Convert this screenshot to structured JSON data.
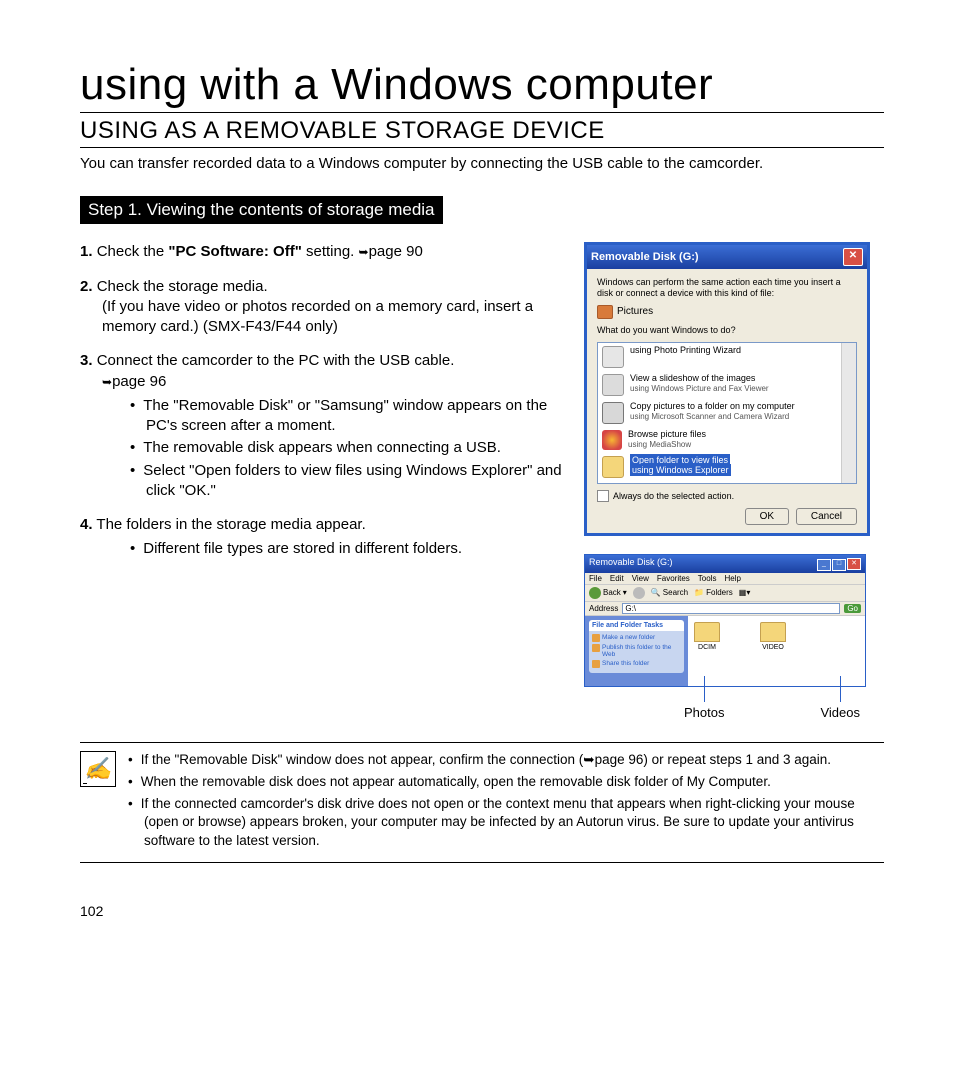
{
  "chapter_title": "using with a Windows computer",
  "section_title": "USING AS A REMOVABLE STORAGE DEVICE",
  "intro": "You can transfer recorded data to a Windows computer by connecting the USB cable to the camcorder.",
  "step_heading": "Step 1. Viewing the contents of storage media",
  "steps": [
    {
      "num": "1.",
      "pre": "Check the ",
      "bold": "\"PC Software: Off\"",
      "post": " setting. ",
      "ref": "page 90"
    },
    {
      "num": "2.",
      "text": "Check the storage media.",
      "sub": "(If you have video or photos recorded on a memory card, insert a memory card.) (SMX-F43/F44 only)"
    },
    {
      "num": "3.",
      "text": "Connect the camcorder to the PC with the USB cable.",
      "ref": "page 96",
      "bullets": [
        "The \"Removable Disk\" or \"Samsung\" window appears on the PC's screen after a moment.",
        "The removable disk appears when connecting a USB.",
        "Select \"Open folders to view files using Windows Explorer\" and click \"OK.\""
      ]
    },
    {
      "num": "4.",
      "text": "The folders in the storage media appear.",
      "bullets": [
        "Different file types are stored in different folders."
      ]
    }
  ],
  "dialog": {
    "title": "Removable Disk (G:)",
    "prompt1": "Windows can perform the same action each time you insert a disk or connect a device with this kind of file:",
    "type_label": "Pictures",
    "prompt2": "What do you want Windows to do?",
    "options": [
      {
        "label": "using Photo Printing Wizard"
      },
      {
        "label": "View a slideshow of the images",
        "sub": "using Windows Picture and Fax Viewer"
      },
      {
        "label": "Copy pictures to a folder on my computer",
        "sub": "using Microsoft Scanner and Camera Wizard"
      },
      {
        "label": "Browse picture files",
        "sub": "using MediaShow"
      },
      {
        "label": "Open folder to view files",
        "sub": "using Windows Explorer",
        "selected": true
      }
    ],
    "checkbox": "Always do the selected action.",
    "ok": "OK",
    "cancel": "Cancel"
  },
  "explorer": {
    "title": "Removable Disk (G:)",
    "menu": [
      "File",
      "Edit",
      "View",
      "Favorites",
      "Tools",
      "Help"
    ],
    "toolbar": {
      "back": "Back",
      "search": "Search",
      "folders": "Folders"
    },
    "address_label": "Address",
    "address_value": "G:\\",
    "go": "Go",
    "tasks_header": "File and Folder Tasks",
    "tasks": [
      "Make a new folder",
      "Publish this folder to the Web",
      "Share this folder"
    ],
    "folders": [
      {
        "name": "DCIM",
        "callout": "Photos"
      },
      {
        "name": "VIDEO",
        "callout": "Videos"
      }
    ]
  },
  "notes": [
    "If the \"Removable Disk\" window does not appear, confirm the connection (➥page 96) or repeat steps 1 and 3 again.",
    "When the removable disk does not appear automatically, open the removable disk folder of My Computer.",
    "If the connected camcorder's disk drive does not open or the context menu that appears when right-clicking your mouse (open or browse) appears broken, your computer may be infected by an Autorun virus. Be sure to update your antivirus software to the latest version."
  ],
  "page_number": "102"
}
